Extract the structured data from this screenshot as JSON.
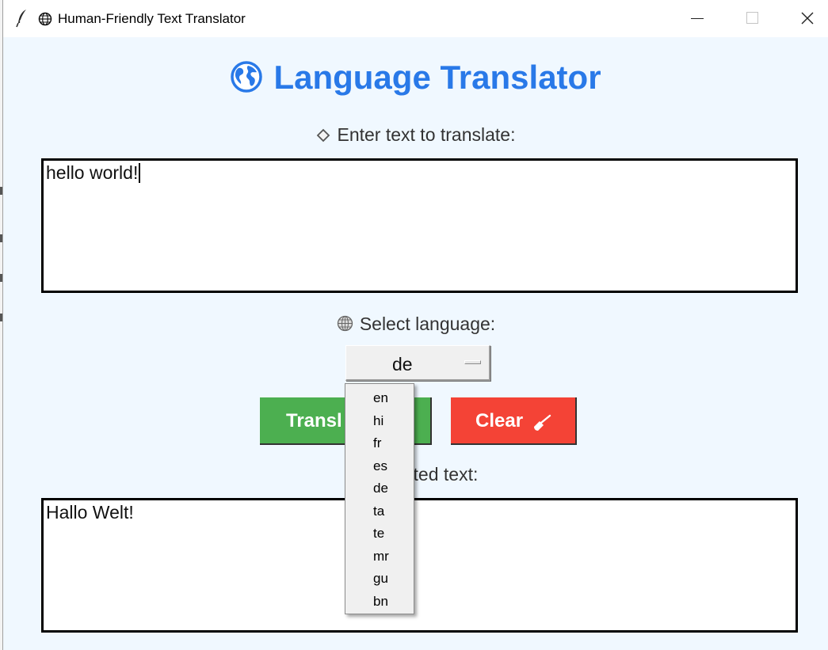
{
  "window": {
    "title": "Human-Friendly Text Translator"
  },
  "app": {
    "heading": "Language Translator",
    "input_label": "Enter text to translate:",
    "input_text": "hello world!",
    "language_label": "Select language:",
    "selected_language": "de",
    "translate_button": "Transl",
    "clear_button": "Clear",
    "output_label_visible": "lated text:",
    "output_text": "Hallo Welt!"
  },
  "dropdown": {
    "options": [
      "en",
      "hi",
      "fr",
      "es",
      "de",
      "ta",
      "te",
      "mr",
      "gu",
      "bn"
    ]
  },
  "colors": {
    "background": "#f0f8ff",
    "heading": "#2979e8",
    "translate_button": "#4caf50",
    "clear_button": "#f44336"
  },
  "icons": {
    "app": "feather-icon",
    "title": "globe-icon",
    "heading": "earth-globe-icon",
    "input_label": "diamond-icon",
    "language_label": "globe-icon",
    "clear_button": "broom-icon"
  }
}
